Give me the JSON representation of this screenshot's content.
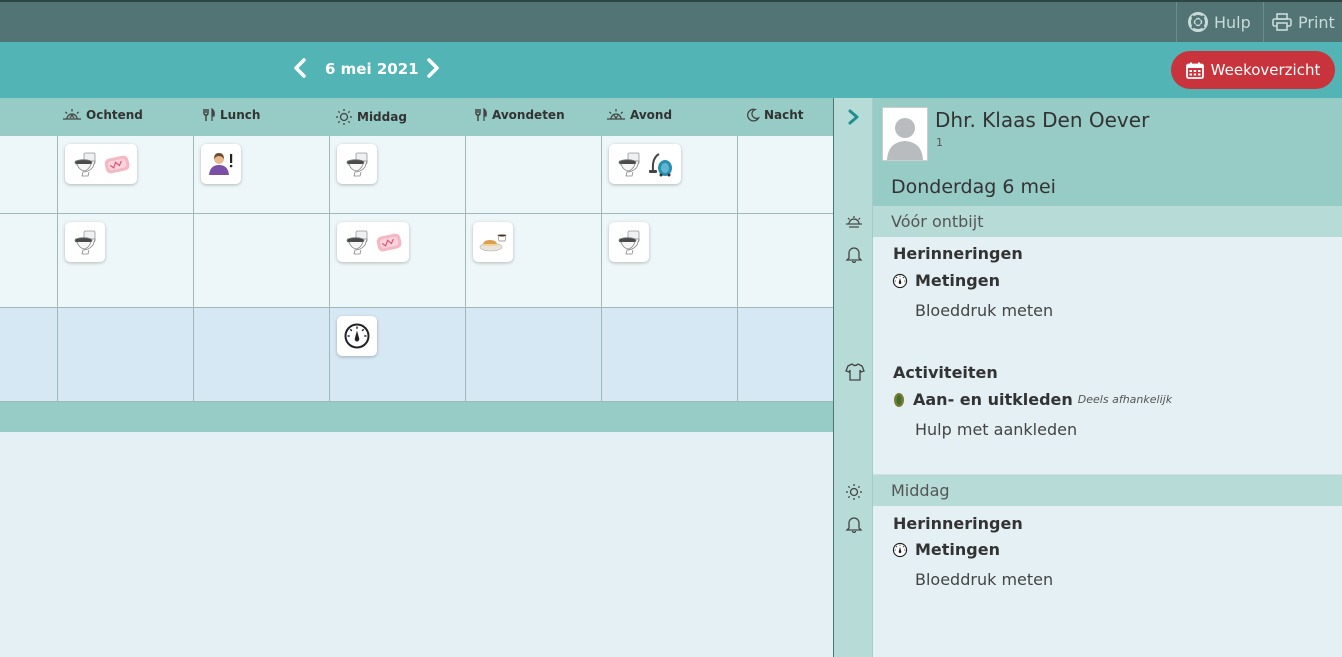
{
  "topbar": {
    "help_label": "Hulp",
    "print_label": "Print",
    "help_icon": "lifebuoy-icon",
    "print_icon": "printer-icon"
  },
  "nav": {
    "date": "6 mei 2021",
    "week_label": "Weekoverzicht",
    "colors": {
      "accent": "#52b4b5",
      "danger": "#c9333b",
      "topbar": "#537474"
    }
  },
  "columns": [
    {
      "label": "Ochtend",
      "icon": "sunrise-icon"
    },
    {
      "label": "Lunch",
      "icon": "cutlery-icon"
    },
    {
      "label": "Middag",
      "icon": "sun-icon"
    },
    {
      "label": "Avondeten",
      "icon": "cutlery-icon"
    },
    {
      "label": "Avond",
      "icon": "sunset-icon"
    },
    {
      "label": "Nacht",
      "icon": "moon-icon"
    }
  ],
  "grid": {
    "rows": [
      {
        "cells": [
          [
            "toilet-icon",
            "incontinence-pad-icon"
          ],
          [
            "caregiver-alert-icon"
          ],
          [
            "toilet-icon"
          ],
          [],
          [
            "toilet-icon",
            "vacuum-cleaner-icon"
          ],
          []
        ]
      },
      {
        "cells": [
          [
            "toilet-icon"
          ],
          [],
          [
            "toilet-icon",
            "incontinence-pad-icon"
          ],
          [
            "bread-coffee-icon"
          ],
          [
            "toilet-icon"
          ],
          []
        ]
      },
      {
        "cells": [
          [],
          [],
          [
            "gauge-icon"
          ],
          [],
          [],
          []
        ]
      }
    ]
  },
  "patient": {
    "name": "Dhr. Klaas Den Oever",
    "number": "1",
    "day": "Donderdag 6 mei"
  },
  "schedule": {
    "before_breakfast": {
      "label": "Vóór ontbijt",
      "reminders_title": "Herinneringen",
      "measurements_title": "Metingen",
      "measurement_item": "Bloeddruk meten",
      "activities_title": "Activiteiten",
      "dressing_title": "Aan- en uitkleden",
      "dressing_note": "Deels afhankelijk",
      "dressing_item": "Hulp met aankleden"
    },
    "afternoon": {
      "label": "Middag",
      "reminders_title": "Herinneringen",
      "measurements_title": "Metingen",
      "measurement_item": "Bloeddruk meten"
    }
  }
}
